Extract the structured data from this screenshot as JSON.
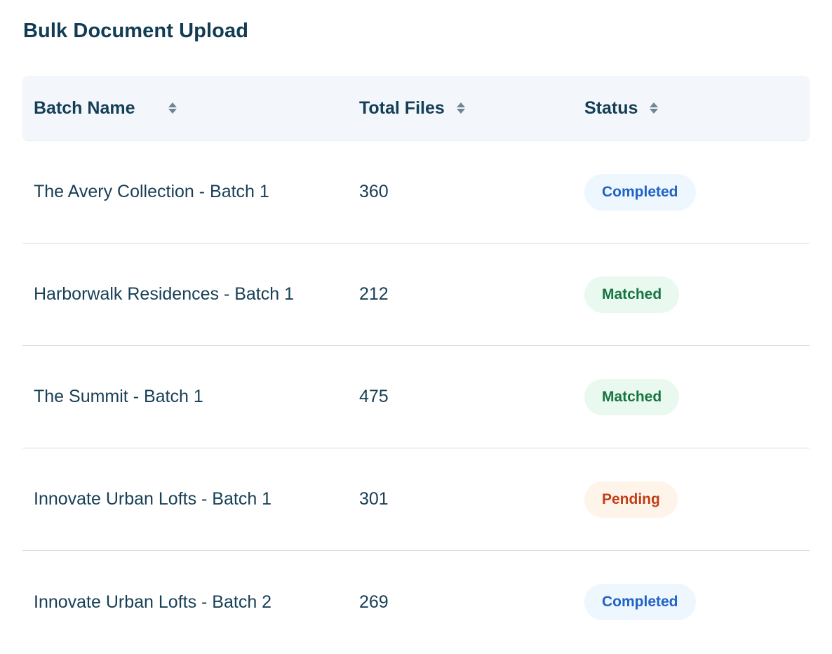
{
  "page": {
    "title": "Bulk Document Upload"
  },
  "table": {
    "columns": [
      {
        "label": "Batch Name",
        "sort_icon": "sort-icon"
      },
      {
        "label": "Total Files",
        "sort_icon": "sort-icon"
      },
      {
        "label": "Status",
        "sort_icon": "sort-icon"
      }
    ],
    "rows": [
      {
        "name": "The Avery Collection - Batch 1",
        "files": "360",
        "status": "Completed",
        "status_kind": "completed"
      },
      {
        "name": "Harborwalk Residences - Batch 1",
        "files": "212",
        "status": "Matched",
        "status_kind": "matched"
      },
      {
        "name": "The Summit - Batch 1",
        "files": "475",
        "status": "Matched",
        "status_kind": "matched"
      },
      {
        "name": "Innovate Urban Lofts - Batch 1",
        "files": "301",
        "status": "Pending",
        "status_kind": "pending"
      },
      {
        "name": "Innovate Urban Lofts - Batch 2",
        "files": "269",
        "status": "Completed",
        "status_kind": "completed"
      }
    ]
  },
  "status_colors": {
    "completed": {
      "text": "#1f63c7",
      "background": "#eef6fe"
    },
    "matched": {
      "text": "#167542",
      "background": "#eaf9ef"
    },
    "pending": {
      "text": "#c13e16",
      "background": "#fff4ea"
    }
  }
}
